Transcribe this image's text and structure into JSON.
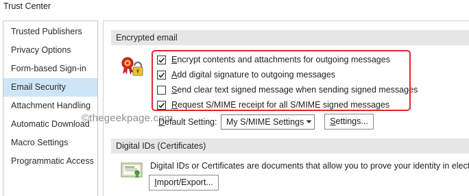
{
  "window": {
    "title": "Trust Center"
  },
  "sidebar": {
    "items": [
      {
        "label": "Trusted Publishers",
        "selected": false
      },
      {
        "label": "Privacy Options",
        "selected": false
      },
      {
        "label": "Form-based Sign-in",
        "selected": false
      },
      {
        "label": "Email Security",
        "selected": true
      },
      {
        "label": "Attachment Handling",
        "selected": false
      },
      {
        "label": "Automatic Download",
        "selected": false
      },
      {
        "label": "Macro Settings",
        "selected": false
      },
      {
        "label": "Programmatic Access",
        "selected": false
      }
    ]
  },
  "watermark": "©thegeekpage.com",
  "encrypted_email": {
    "header": "Encrypted email",
    "icon": "certificate-lock-icon",
    "options": [
      {
        "mnemonic": "E",
        "rest": "ncrypt contents and attachments for outgoing messages",
        "checked": true
      },
      {
        "mnemonic": "A",
        "rest": "dd digital signature to outgoing messages",
        "checked": true
      },
      {
        "mnemonic": "S",
        "rest": "end clear text signed message when sending signed messages",
        "checked": false
      },
      {
        "mnemonic": "R",
        "rest": "equest S/MIME receipt for all S/MIME signed messages",
        "checked": true
      }
    ],
    "default_setting": {
      "label_before": "",
      "label_mnemonic": "D",
      "label_after": "efault Setting:",
      "selected_value": "My S/MIME Settings"
    },
    "settings_button": {
      "label_before": "",
      "label_mnemonic": "S",
      "label_after": "ettings..."
    }
  },
  "digital_ids": {
    "header": "Digital IDs (Certificates)",
    "icon": "certificate-icon",
    "description": "Digital IDs or Certificates are documents that allow you to prove your identity in electron",
    "import_export_button": {
      "label_before": "",
      "label_mnemonic": "I",
      "label_after": "mport/Export..."
    }
  },
  "colors": {
    "selected_item_bg": "#cde5f7",
    "section_header_bg": "#e6e6e6",
    "highlight_border": "#e0262b"
  }
}
